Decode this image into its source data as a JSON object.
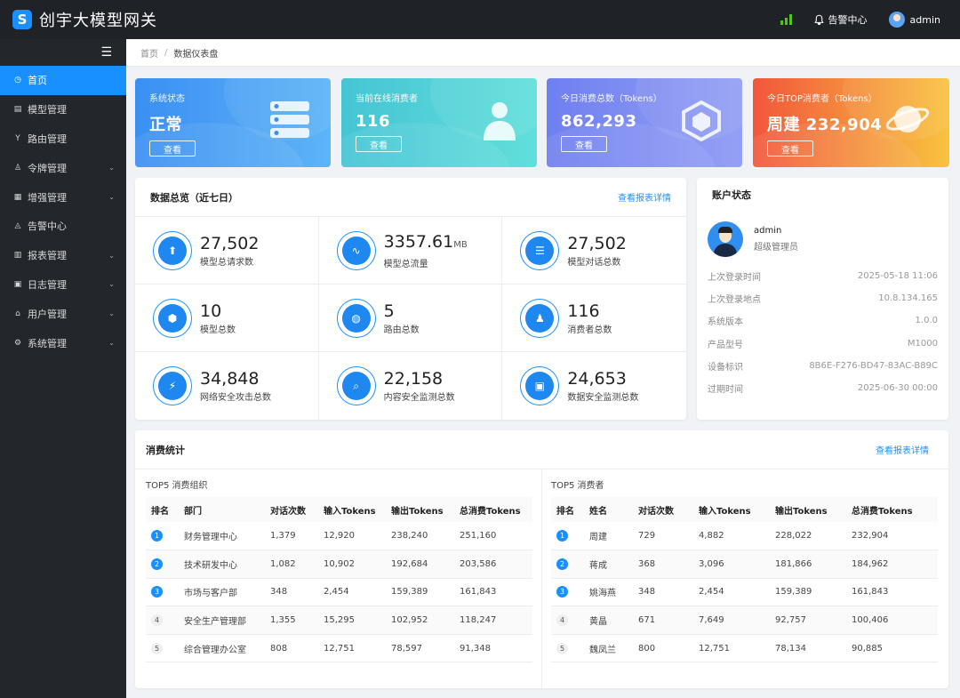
{
  "app": {
    "title": "创宇大模型网关",
    "logo_letter": "S"
  },
  "topbar": {
    "alarm_label": "告警中心",
    "username": "admin",
    "signal_color": "#52c41a"
  },
  "sidebar": {
    "items": [
      {
        "label": "首页",
        "icon": "dashboard-icon",
        "glyph": "◷",
        "active": true,
        "expandable": false
      },
      {
        "label": "模型管理",
        "icon": "model-icon",
        "glyph": "▤",
        "active": false,
        "expandable": false
      },
      {
        "label": "路由管理",
        "icon": "route-icon",
        "glyph": "Y",
        "active": false,
        "expandable": false
      },
      {
        "label": "令牌管理",
        "icon": "token-icon",
        "glyph": "♙",
        "active": false,
        "expandable": true
      },
      {
        "label": "增强管理",
        "icon": "enhance-icon",
        "glyph": "▦",
        "active": false,
        "expandable": true
      },
      {
        "label": "告警中心",
        "icon": "bell-icon",
        "glyph": "◬",
        "active": false,
        "expandable": false
      },
      {
        "label": "报表管理",
        "icon": "report-icon",
        "glyph": "▥",
        "active": false,
        "expandable": true
      },
      {
        "label": "日志管理",
        "icon": "log-icon",
        "glyph": "▣",
        "active": false,
        "expandable": true
      },
      {
        "label": "用户管理",
        "icon": "user-icon",
        "glyph": "⌂",
        "active": false,
        "expandable": true
      },
      {
        "label": "系统管理",
        "icon": "settings-icon",
        "glyph": "⚙",
        "active": false,
        "expandable": true
      }
    ]
  },
  "breadcrumb": {
    "home": "首页",
    "separator": "/",
    "current": "数据仪表盘"
  },
  "stat_cards": [
    {
      "title": "系统状态",
      "value": "正常",
      "button": "查看",
      "colors": [
        "#3a8ff2",
        "#5db4f7"
      ],
      "icon": "server-icon"
    },
    {
      "title": "当前在线消费者",
      "value": "116",
      "button": "查看",
      "colors": [
        "#45c4d4",
        "#61dfdb"
      ],
      "icon": "person-icon"
    },
    {
      "title": "今日消费总数（Tokens）",
      "value": "862,293",
      "button": "查看",
      "colors": [
        "#6f7ff0",
        "#93a0f4"
      ],
      "icon": "cube-icon"
    },
    {
      "title": "今日TOP消费者（Tokens）",
      "value": "周建 232,904",
      "button": "查看",
      "colors": [
        "#f2563c",
        "#f8c33f"
      ],
      "icon": "planet-icon"
    }
  ],
  "overview": {
    "title": "数据总览（近七日）",
    "link": "查看报表详情",
    "metrics": [
      {
        "value": "27,502",
        "unit": "",
        "label": "模型总请求数",
        "icon": "request-icon",
        "glyph": "⬆"
      },
      {
        "value": "3357.61",
        "unit": "MB",
        "label": "模型总流量",
        "icon": "traffic-icon",
        "glyph": "∿"
      },
      {
        "value": "27,502",
        "unit": "",
        "label": "模型对话总数",
        "icon": "chat-icon",
        "glyph": "☰"
      },
      {
        "value": "10",
        "unit": "",
        "label": "模型总数",
        "icon": "cube-icon",
        "glyph": "⬢"
      },
      {
        "value": "5",
        "unit": "",
        "label": "路由总数",
        "icon": "route-icon",
        "glyph": "◍"
      },
      {
        "value": "116",
        "unit": "",
        "label": "消费者总数",
        "icon": "consumer-icon",
        "glyph": "♟"
      },
      {
        "value": "34,848",
        "unit": "",
        "label": "网络安全攻击总数",
        "icon": "shield-icon",
        "glyph": "⚡"
      },
      {
        "value": "22,158",
        "unit": "",
        "label": "内容安全监测总数",
        "icon": "doc-search-icon",
        "glyph": "⌕"
      },
      {
        "value": "24,653",
        "unit": "",
        "label": "数据安全监测总数",
        "icon": "data-shield-icon",
        "glyph": "▣"
      }
    ]
  },
  "account": {
    "title": "账户状态",
    "name": "admin",
    "role": "超级管理员",
    "rows": [
      {
        "label": "上次登录时间",
        "value": "2025-05-18 11:06"
      },
      {
        "label": "上次登录地点",
        "value": "10.8.134.165"
      },
      {
        "label": "系统版本",
        "value": "1.0.0"
      },
      {
        "label": "产品型号",
        "value": "M1000"
      },
      {
        "label": "设备标识",
        "value": "8B6E-F276-BD47-83AC-B89C"
      },
      {
        "label": "过期时间",
        "value": "2025-06-30 00:00"
      }
    ]
  },
  "consumption": {
    "title": "消费统计",
    "link": "查看报表详情",
    "org_table": {
      "caption": "TOP5 消费组织",
      "headers": [
        "排名",
        "部门",
        "对话次数",
        "输入Tokens",
        "输出Tokens",
        "总消费Tokens"
      ],
      "rows": [
        [
          "1",
          "财务管理中心",
          "1,379",
          "12,920",
          "238,240",
          "251,160"
        ],
        [
          "2",
          "技术研发中心",
          "1,082",
          "10,902",
          "192,684",
          "203,586"
        ],
        [
          "3",
          "市场与客户部",
          "348",
          "2,454",
          "159,389",
          "161,843"
        ],
        [
          "4",
          "安全生产管理部",
          "1,355",
          "15,295",
          "102,952",
          "118,247"
        ],
        [
          "5",
          "综合管理办公室",
          "808",
          "12,751",
          "78,597",
          "91,348"
        ]
      ]
    },
    "consumer_table": {
      "caption": "TOP5 消费者",
      "headers": [
        "排名",
        "姓名",
        "对话次数",
        "输入Tokens",
        "输出Tokens",
        "总消费Tokens"
      ],
      "rows": [
        [
          "1",
          "周建",
          "729",
          "4,882",
          "228,022",
          "232,904"
        ],
        [
          "2",
          "蒋成",
          "368",
          "3,096",
          "181,866",
          "184,962"
        ],
        [
          "3",
          "姚海燕",
          "348",
          "2,454",
          "159,389",
          "161,843"
        ],
        [
          "4",
          "黄晶",
          "671",
          "7,649",
          "92,757",
          "100,406"
        ],
        [
          "5",
          "魏凤兰",
          "800",
          "12,751",
          "78,134",
          "90,885"
        ]
      ]
    }
  }
}
